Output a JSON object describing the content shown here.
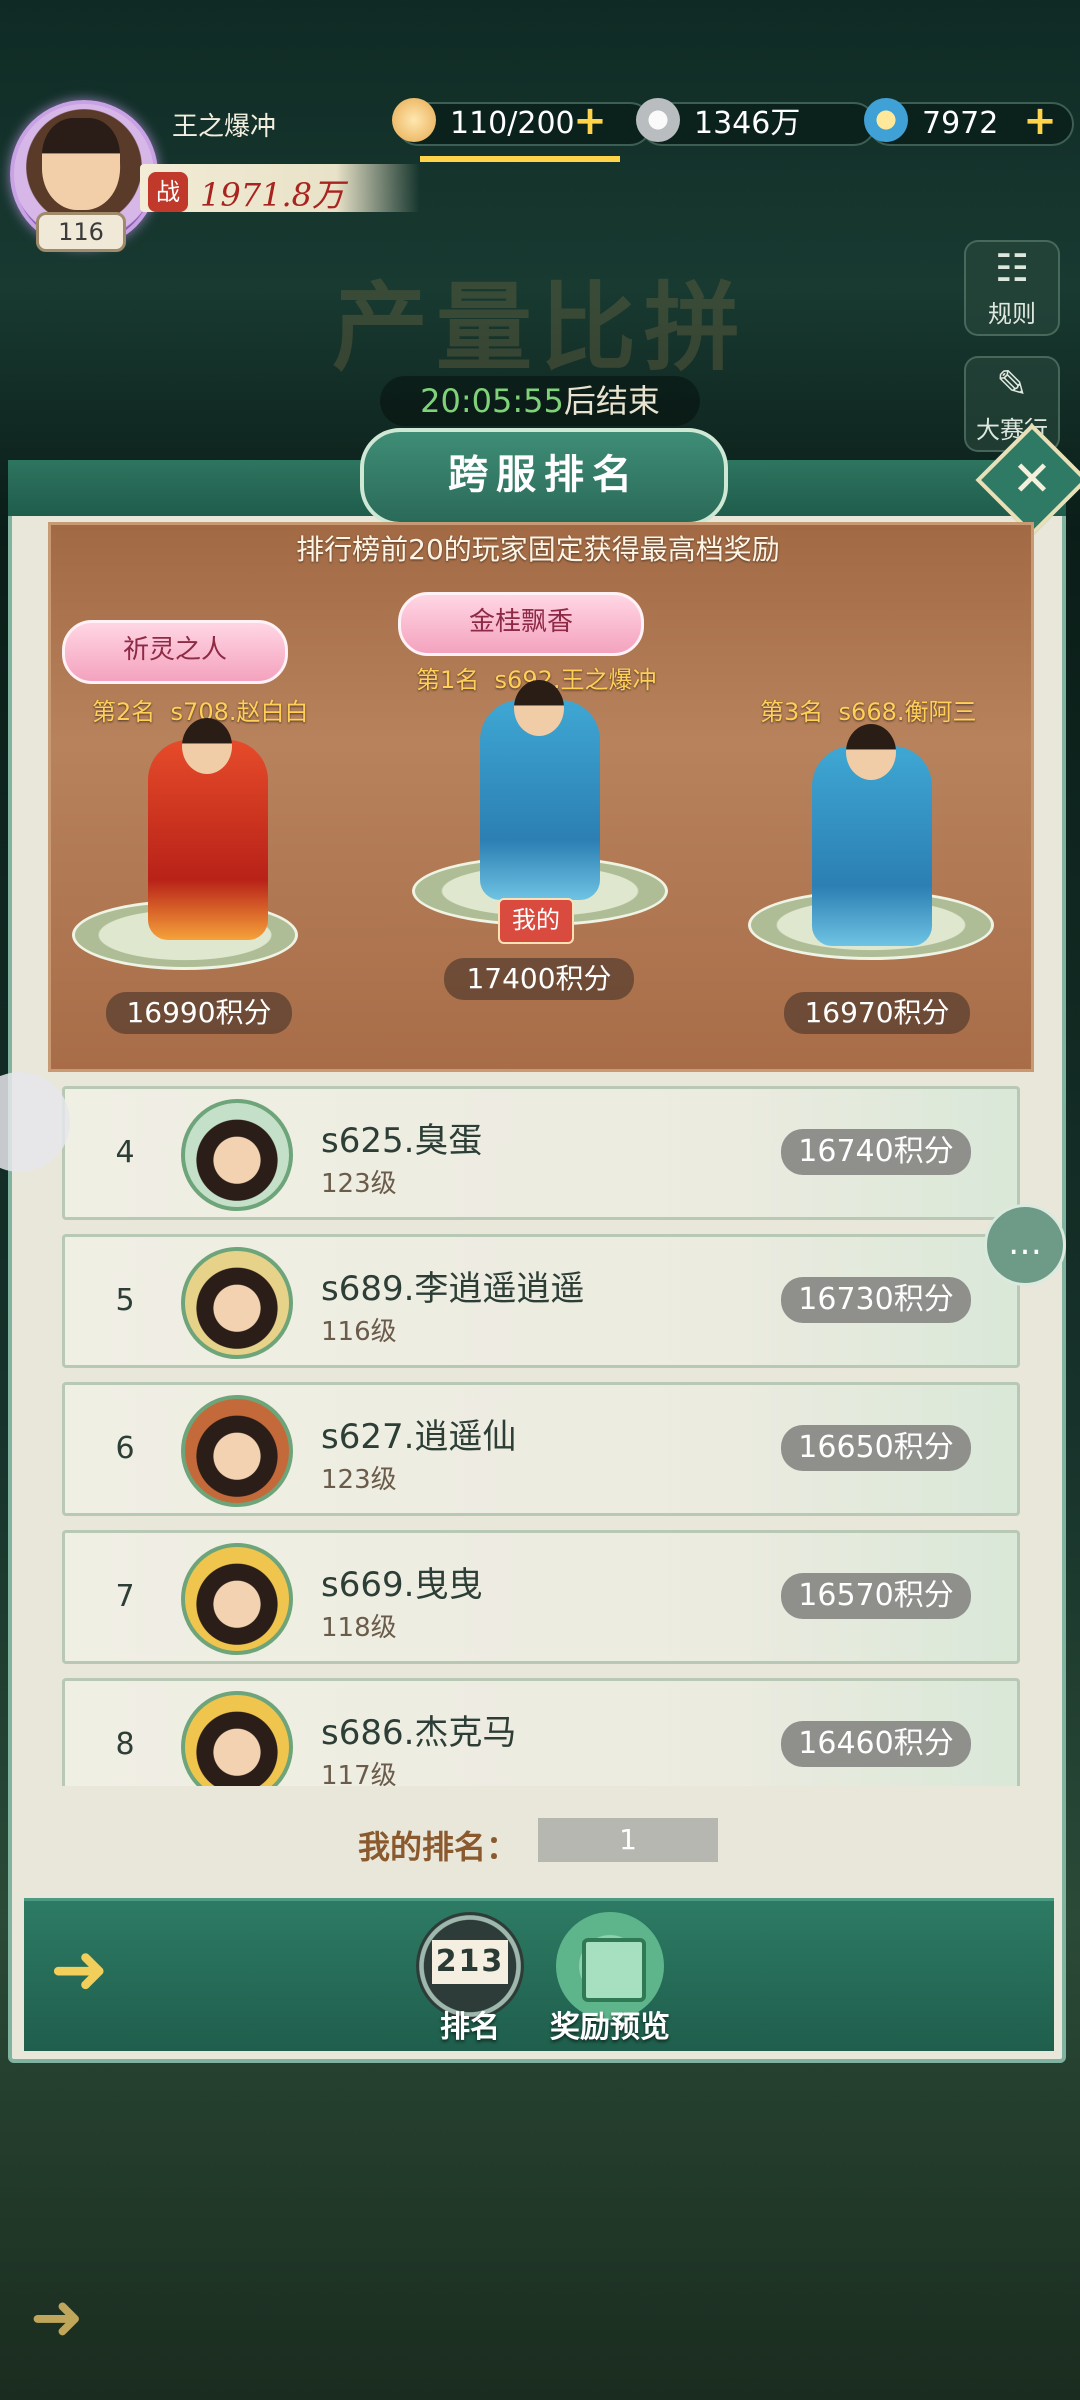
{
  "player": {
    "name": "王之爆冲",
    "level": "116",
    "power_prefix": "战",
    "power": "1971.8万"
  },
  "resources": {
    "stamina": "110/200",
    "coins": "1346万",
    "gems": "7972",
    "plus": "+"
  },
  "header": {
    "title": "产量比拼",
    "timer_value": "20:05:55",
    "timer_suffix": "后结束",
    "rules_label": "规则",
    "schedule_label": "大赛行程"
  },
  "panel": {
    "title": "跨服排名",
    "note": "排行榜前20的玩家固定获得最高档奖励",
    "close": "✕"
  },
  "podium": [
    {
      "rank_label": "第2名",
      "server_name": "s708.赵白白",
      "title": "祈灵之人",
      "score": "16990积分"
    },
    {
      "rank_label": "第1名",
      "server_name": "s692.王之爆冲",
      "title": "金桂飘香",
      "score": "17400积分",
      "mine": "我的"
    },
    {
      "rank_label": "第3名",
      "server_name": "s668.衡阿三",
      "score": "16970积分"
    }
  ],
  "list": [
    {
      "rank": "4",
      "name": "s625.臭蛋",
      "level": "123级",
      "score": "16740积分"
    },
    {
      "rank": "5",
      "name": "s689.李逍遥逍遥",
      "level": "116级",
      "score": "16730积分"
    },
    {
      "rank": "6",
      "name": "s627.逍遥仙",
      "level": "123级",
      "score": "16650积分"
    },
    {
      "rank": "7",
      "name": "s669.曳曳",
      "level": "118级",
      "score": "16570积分"
    },
    {
      "rank": "8",
      "name": "s686.杰克马",
      "level": "117级",
      "score": "16460积分"
    }
  ],
  "my_rank": {
    "label": "我的排名：",
    "value": "1"
  },
  "bottom": {
    "ranking_tab": "排名",
    "ranking_icon_text": "213",
    "reward_tab": "奖励预览"
  },
  "colors": {
    "accent_green": "#2e7560",
    "gold": "#ffcf57",
    "mine_red": "#d94b3f"
  }
}
